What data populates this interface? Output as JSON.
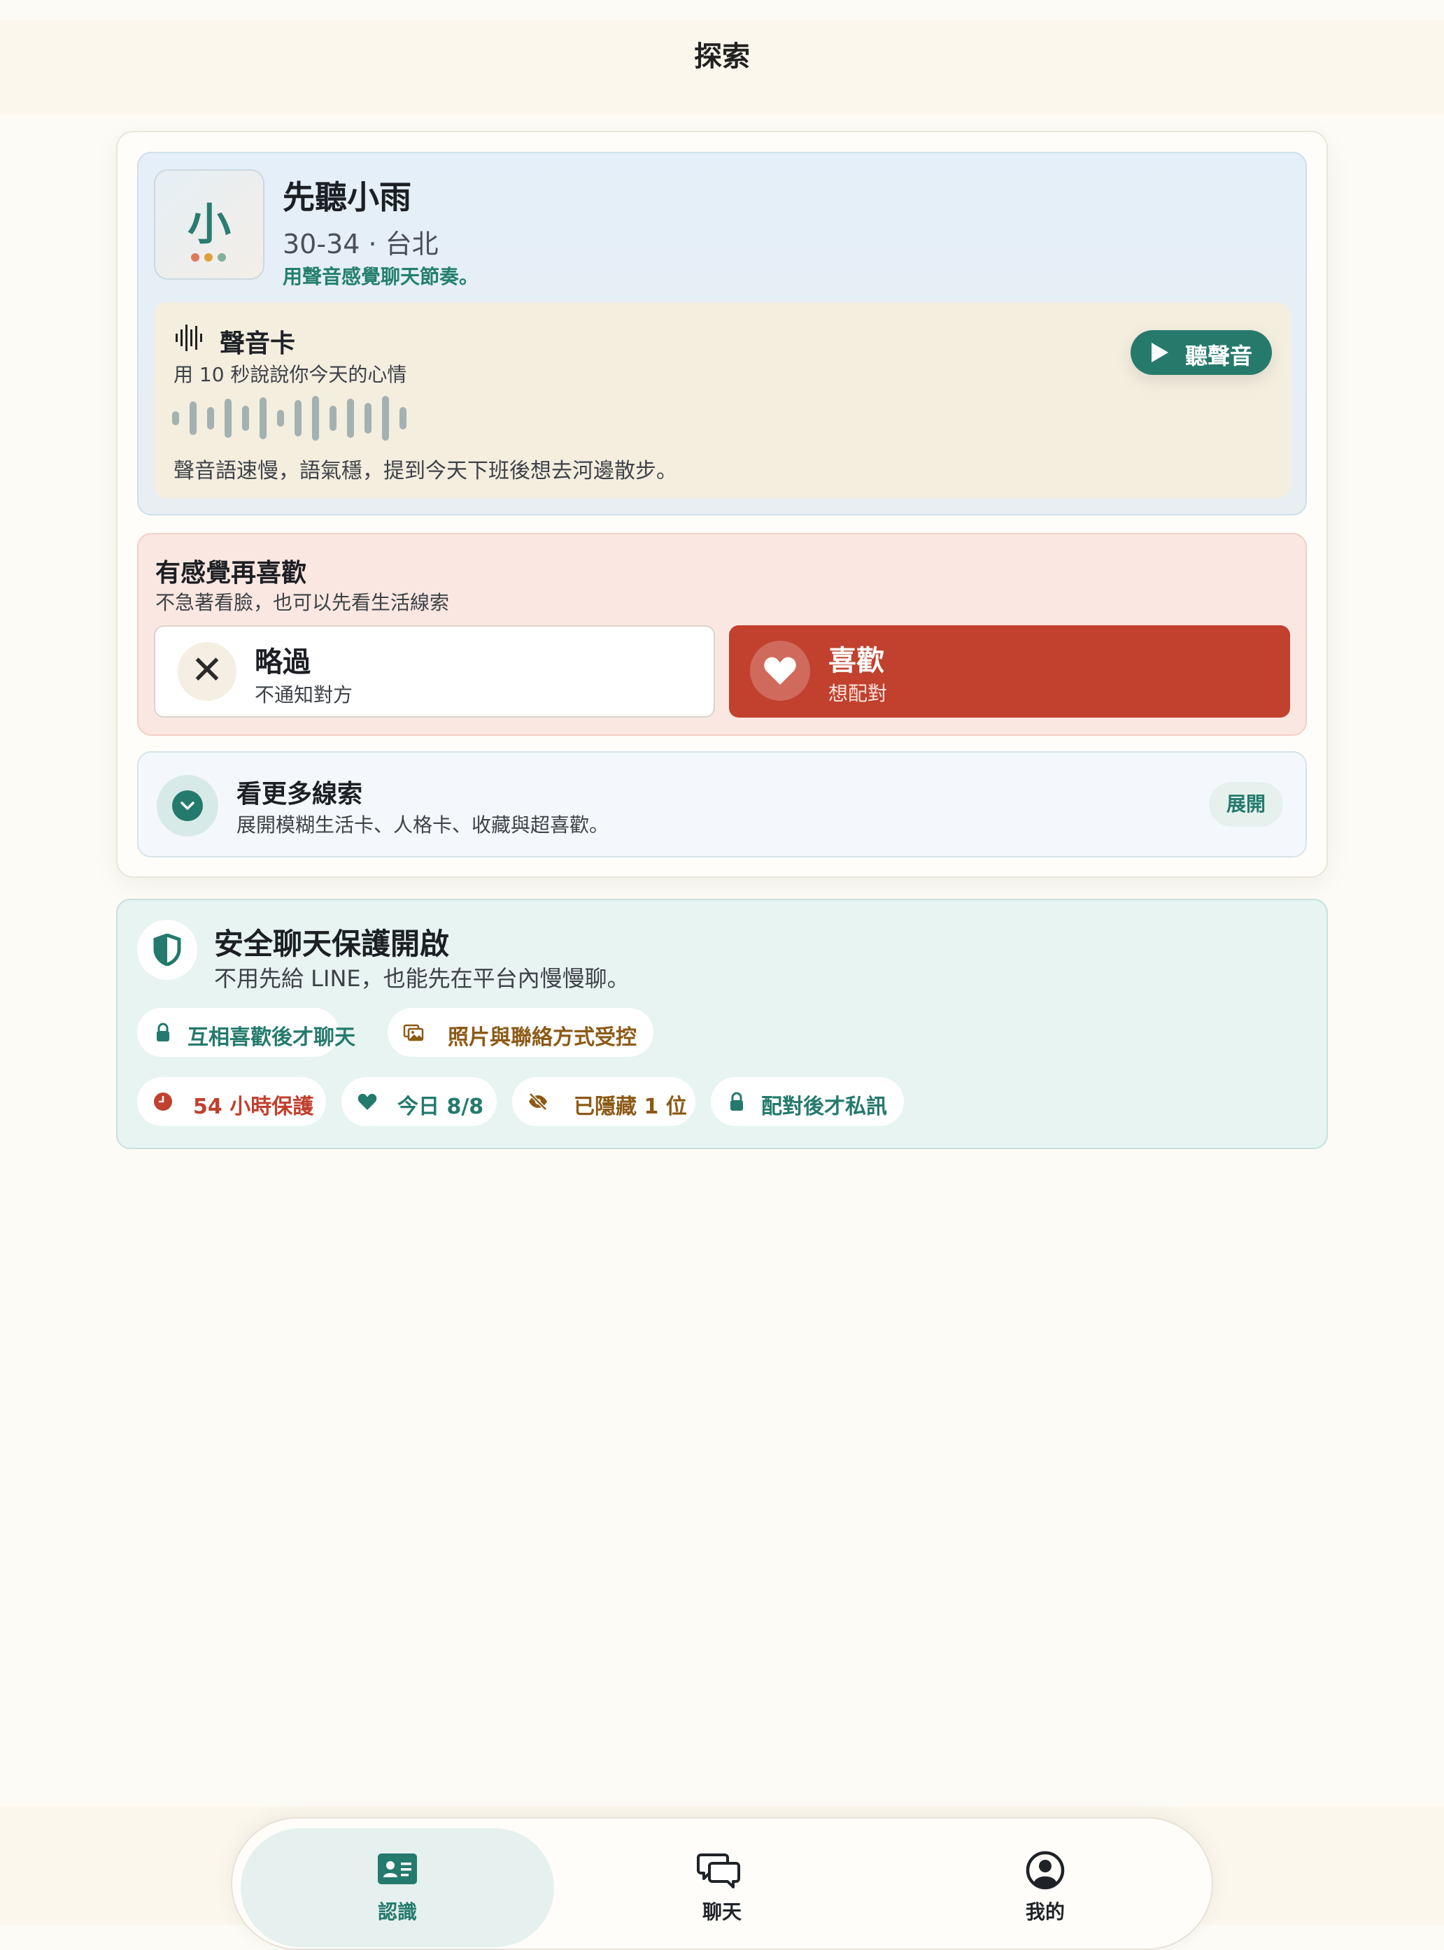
{
  "header": {
    "title": "探索"
  },
  "profile": {
    "avatar_char": "小",
    "name": "先聽小雨",
    "meta": "30-34 · 台北",
    "tagline": "用聲音感覺聊天節奏。"
  },
  "voice_card": {
    "title": "聲音卡",
    "prompt": "用 10 秒說說你今天的心情",
    "play_label": "聽聲音",
    "description": "聲音語速慢，語氣穩，提到今天下班後想去河邊散步。"
  },
  "decision": {
    "title": "有感覺再喜歡",
    "subtitle": "不急著看臉，也可以先看生活線索",
    "skip": {
      "label": "略過",
      "sub": "不通知對方"
    },
    "like": {
      "label": "喜歡",
      "sub": "想配對"
    }
  },
  "more": {
    "title": "看更多線索",
    "subtitle": "展開模糊生活卡、人格卡、收藏與超喜歡。",
    "button": "展開"
  },
  "safety": {
    "title": "安全聊天保護開啟",
    "subtitle": "不用先給 LINE，也能先在平台內慢慢聊。",
    "pills": [
      {
        "label": "互相喜歡後才聊天",
        "icon": "lock-icon",
        "color": "#247a6c"
      },
      {
        "label": "照片與聯絡方式受控",
        "icon": "photos-icon",
        "color": "#8c5a16"
      },
      {
        "label": "54 小時保護",
        "icon": "clock-icon",
        "color": "#c1402e"
      },
      {
        "label": "今日 8/8",
        "icon": "heart-icon",
        "color": "#247a6c"
      },
      {
        "label": "已隱藏 1 位",
        "icon": "eye-off-icon",
        "color": "#8c5a16"
      },
      {
        "label": "配對後才私訊",
        "icon": "lock-icon",
        "color": "#247a6c"
      }
    ]
  },
  "nav": {
    "items": [
      {
        "label": "認識",
        "icon": "profile-card-icon",
        "active": true
      },
      {
        "label": "聊天",
        "icon": "chat-bubbles-icon",
        "active": false
      },
      {
        "label": "我的",
        "icon": "user-circle-icon",
        "active": false
      }
    ]
  },
  "colors": {
    "accent": "#247a6c",
    "like": "#c1402e",
    "background": "#fdfbf6"
  }
}
